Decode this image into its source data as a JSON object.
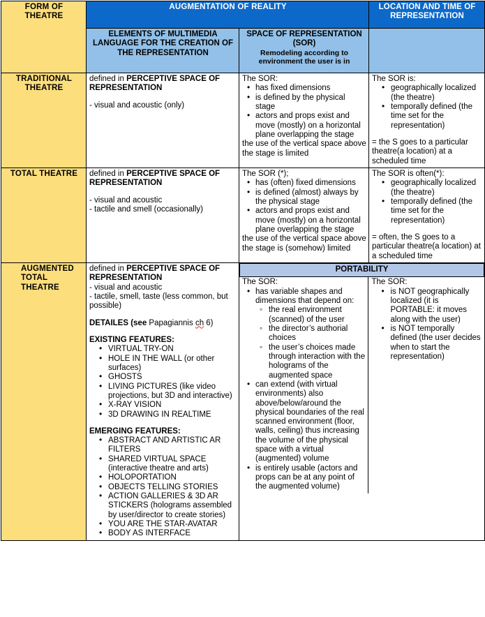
{
  "header": {
    "col_form": "FORM OF\nTHEATRE",
    "col_aor": "AUGMENTATION OF REALITY",
    "col_loc": "LOCATION AND TIME OF REPRESENTATION",
    "sub_elements": "ELEMENTS OF MULTIMEDIA LANGUAGE FOR THE CREATION OF THE REPRESENTATION",
    "sub_sor_line1": "SPACE OF REPRESENTATION (SOR)",
    "sub_sor_line2": "Remodeling  according to environment the user is in"
  },
  "colors": {
    "header_blue": "#0D69C9",
    "subheader_blue": "#92C0E8",
    "portability_blue": "#B2C6E8",
    "row_label_yellow": "#FCDE7C",
    "border": "#000000",
    "spellcheck_red": "#E03030"
  },
  "rows": [
    {
      "label": "TRADITIONAL THEATRE",
      "elements": {
        "lead_plain": "defined in ",
        "lead_bold": "PERCEPTIVE SPACE OF REPRESENTATION",
        "items": [
          "- visual and acoustic (only)"
        ]
      },
      "sor": {
        "intro": "The SOR:",
        "bullets": [
          "has fixed dimensions",
          "is defined by the physical stage",
          "actors and props exist and move (mostly) on a horizontal plane overlapping the stage"
        ],
        "tail": "the use of the vertical space above the stage is limited"
      },
      "location": {
        "intro": "The SOR is:",
        "bullets": [
          "geographically localized (the theatre)",
          "temporally defined (the time set for the representation)"
        ],
        "tail": "= the S goes to a particular theatre(a location) at a scheduled time"
      }
    },
    {
      "label": "TOTAL THEATRE",
      "elements": {
        "lead_plain": "defined in ",
        "lead_bold": "PERCEPTIVE SPACE OF REPRESENTATION",
        "items": [
          "- visual and acoustic",
          "- tactile and smell (occasionally)"
        ]
      },
      "sor": {
        "intro": "The SOR (*);",
        "bullets": [
          "has (often) fixed dimensions",
          "is defined (almost) always by the physical stage",
          "actors and props exist and move (mostly) on a horizontal plane overlapping the stage"
        ],
        "tail": "the use of the vertical space above the stage is (somehow) limited"
      },
      "location": {
        "intro": "The SOR is often(*):",
        "bullets": [
          "geographically localized (the theatre)",
          "temporally defined (the time set for the representation)"
        ],
        "tail": "= often, the S goes to a particular theatre(a location) at a scheduled time"
      }
    }
  ],
  "row3": {
    "label": "AUGMENTED TOTAL THEATRE",
    "elements": {
      "lead_plain": "defined in ",
      "lead_bold": "PERCEPTIVE SPACE OF REPRESENTATION",
      "items": [
        "- visual and acoustic",
        "- tactile, smell, taste (less common, but possible)"
      ],
      "detailes_bold": "DETAILES (see",
      "detailes_plain": " Papagiannis ",
      "detailes_spellerr": "ch",
      "detailes_tail": " 6)",
      "existing_heading": "EXISTING FEATURES:",
      "existing": [
        "VIRTUAL TRY-ON",
        "HOLE IN THE WALL (or other surfaces)",
        "GHOSTS",
        "LIVING PICTURES (like video projections, but 3D and interactive)",
        "X-RAY VISION",
        "3D DRAWING IN REALTIME"
      ],
      "emerging_heading": "EMERGING FEATURES:",
      "emerging": [
        "ABSTRACT AND ARTISTIC AR FILTERS",
        "SHARED VIRTUAL SPACE (interactive theatre and arts)",
        "HOLOPORTATION",
        "OBJECTS TELLING STORIES",
        "ACTION GALLERIES & 3D AR STICKERS (holograms assembled by user/director to create stories)",
        "YOU ARE THE STAR-AVATAR",
        "BODY AS INTERFACE"
      ]
    },
    "portability_label": "PORTABILITY",
    "sor": {
      "intro": "The SOR:",
      "b1": "has variable shapes and dimensions that depend on:",
      "subs": [
        "the real environment (scanned) of the user",
        "the director’s authorial choices",
        "the user’s choices made through interaction with the holograms of the augmented space"
      ],
      "b2": "can extend (with virtual environments) also above/below/around the physical boundaries of the real scanned environment (floor, walls, ceiling) thus increasing the volume of the physical space with a virtual (augmented) volume",
      "b3": "is entirely usable (actors and props can be at any point of the augmented volume)"
    },
    "location": {
      "intro": "The SOR:",
      "bullets": [
        "is NOT geographically localized (it is PORTABLE: it moves along with the user)",
        "is NOT temporally defined (the user decides when to start the representation)"
      ]
    }
  }
}
